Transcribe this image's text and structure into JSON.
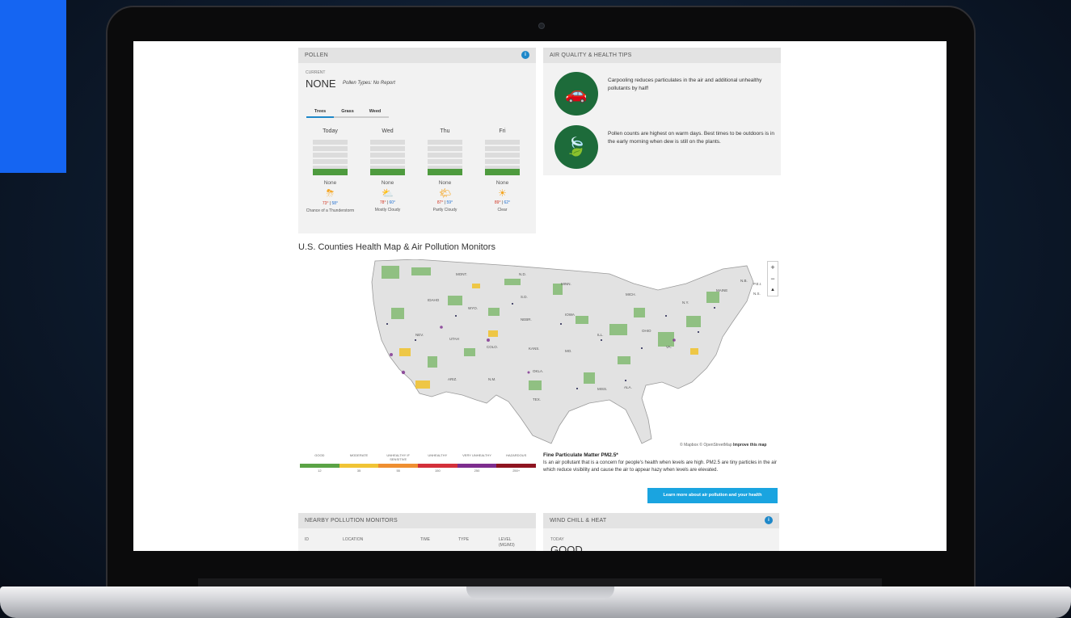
{
  "pollen": {
    "title": "POLLEN",
    "info": "i",
    "current_label": "CURRENT",
    "current_value": "NONE",
    "types": "Pollen Types: No Report",
    "tabs": [
      "Trees",
      "Grass",
      "Weed"
    ],
    "days": [
      {
        "name": "Today",
        "level": "None",
        "icon": "thunderstorm-icon",
        "glyph": "⛈",
        "high": "73°",
        "low": "58°",
        "condition": "Chance of a Thunderstorm"
      },
      {
        "name": "Wed",
        "level": "None",
        "icon": "cloud-sun-icon",
        "glyph": "⛅",
        "high": "78°",
        "low": "60°",
        "condition": "Mostly Cloudy"
      },
      {
        "name": "Thu",
        "level": "None",
        "icon": "partly-cloudy-icon",
        "glyph": "🌤",
        "high": "87°",
        "low": "59°",
        "condition": "Partly Cloudy"
      },
      {
        "name": "Fri",
        "level": "None",
        "icon": "sun-icon",
        "glyph": "☀",
        "high": "89°",
        "low": "62°",
        "condition": "Clear"
      }
    ]
  },
  "tips": {
    "title": "AIR QUALITY & HEALTH TIPS",
    "items": [
      {
        "icon": "car-icon",
        "glyph": "🚗",
        "text": "Carpooling reduces particulates in the air and additional unhealthy pollutants by half!"
      },
      {
        "icon": "leaf-icon",
        "glyph": "🍃",
        "text": "Pollen counts are highest on warm days. Best times to be outdoors is in the early morning when dew is still on the plants."
      }
    ]
  },
  "map": {
    "title": "U.S. Counties Health Map & Air Pollution Monitors",
    "zoom_in": "+",
    "zoom_out": "−",
    "compass": "▲",
    "attribution": "© Mapbox © OpenStreetMap",
    "improve": "Improve this map",
    "state_labels": [
      "MONT.",
      "N.D.",
      "S.D.",
      "MINN.",
      "IDAHO",
      "WYO.",
      "NEBR.",
      "IOWA",
      "NEV.",
      "UTAH",
      "COLO.",
      "KANS.",
      "MO.",
      "ILL.",
      "OHIO",
      "ARIZ.",
      "N.M.",
      "OKLA.",
      "TEX.",
      "MISS.",
      "ALA.",
      "MICH.",
      "N.Y.",
      "MAINE",
      "VA.",
      "N.B.",
      "P.E.I.",
      "N.S."
    ]
  },
  "legend": {
    "labels": [
      "GOOD",
      "MODERATE",
      "UNHEALTHY IF SENSITIVE",
      "UNHEALTHY",
      "VERY UNHEALTHY",
      "HAZARDOUS"
    ],
    "values": [
      "12",
      "35",
      "55",
      "150",
      "250",
      "250+"
    ],
    "colors": [
      "#5aa345",
      "#f0c435",
      "#ef8f31",
      "#d3303a",
      "#7d2d8e",
      "#8f1420"
    ]
  },
  "fpm": {
    "title": "Fine Particulate Matter PM2.5*",
    "desc": "Is an air pollutant that is a concern for people's health when levels are high. PM2.5 are tiny particles in the air which reduce visibility and cause the air to appear hazy when levels are elevated.",
    "button": "Learn more about air pollution and your health"
  },
  "nearby": {
    "title": "NEARBY POLLUTION MONITORS",
    "columns": [
      "ID",
      "LOCATION",
      "TIME",
      "TYPE",
      "LEVEL (MG/M3)"
    ]
  },
  "wind": {
    "title": "WIND CHILL & HEAT",
    "info": "i",
    "today_label": "TODAY",
    "value": "GOOD"
  }
}
